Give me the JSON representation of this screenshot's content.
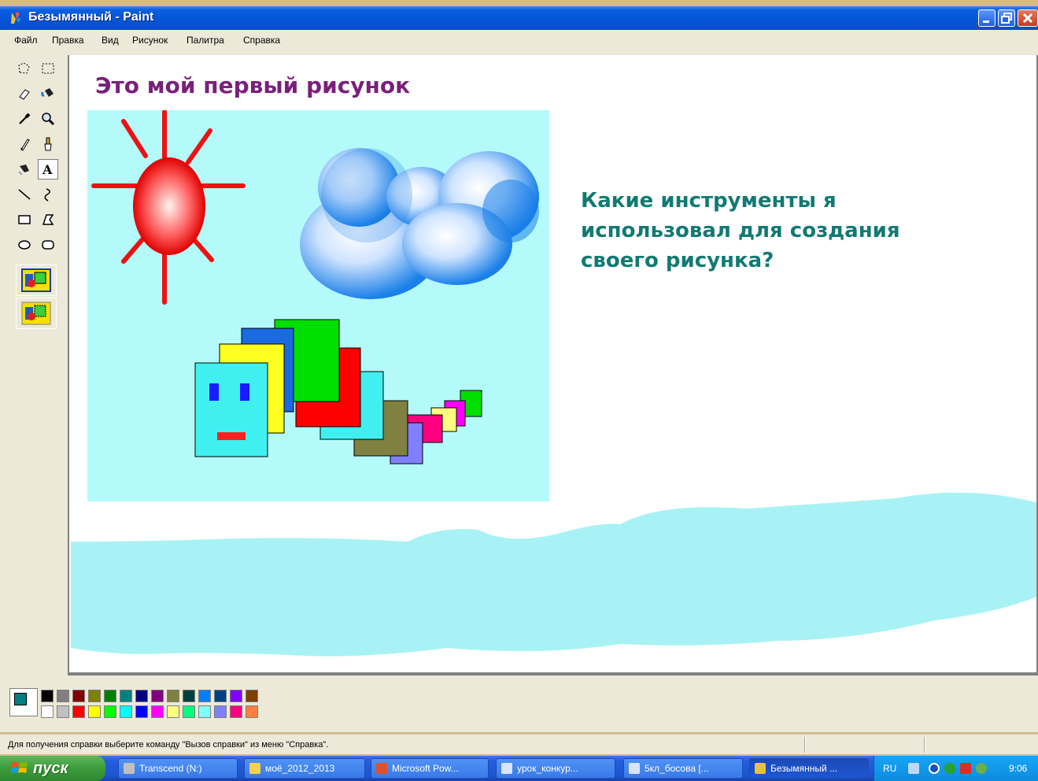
{
  "window": {
    "title": "Безымянный - Paint",
    "menu": [
      "Файл",
      "Правка",
      "Вид",
      "Рисунок",
      "Палитра",
      "Справка"
    ]
  },
  "canvas": {
    "heading": "Это мой первый рисунок",
    "question": "Какие инструменты я использовал для создания своего рисунка?",
    "colors": {
      "heading": "#7b1f7b",
      "question": "#117a72",
      "sky": "#b4fafa",
      "cyan_stroke": "#a8f2f5"
    }
  },
  "tools": [
    "free-form-select-icon",
    "select-icon",
    "eraser-icon",
    "fill-icon",
    "pick-color-icon",
    "magnifier-icon",
    "pencil-icon",
    "brush-icon",
    "airbrush-icon",
    "text-icon",
    "line-icon",
    "curve-icon",
    "rectangle-icon",
    "polygon-icon",
    "ellipse-icon",
    "rounded-rectangle-icon"
  ],
  "palette": {
    "top": [
      "#000000",
      "#808080",
      "#800000",
      "#808000",
      "#008000",
      "#008080",
      "#000080",
      "#800080",
      "#808040",
      "#004040",
      "#0080ff",
      "#004080",
      "#8000ff",
      "#804000"
    ],
    "bottom": [
      "#ffffff",
      "#c0c0c0",
      "#ff0000",
      "#ffff00",
      "#00ff00",
      "#00ffff",
      "#0000ff",
      "#ff00ff",
      "#ffff80",
      "#00ff80",
      "#80ffff",
      "#8080ff",
      "#ff0080",
      "#ff8040"
    ],
    "foreground": "#008080",
    "background": "#ffffff"
  },
  "status": {
    "text": "Для получения справки выберите команду \"Вызов справки\" из меню \"Справка\"."
  },
  "taskbar": {
    "start": "пуск",
    "tasks": [
      "Transcend (N:)",
      "моё_2012_2013",
      "Microsoft Pow...",
      "урок_конкур...",
      "5кл_босова [...",
      "Безымянный ..."
    ],
    "lang": "RU",
    "clock": "9:06"
  }
}
